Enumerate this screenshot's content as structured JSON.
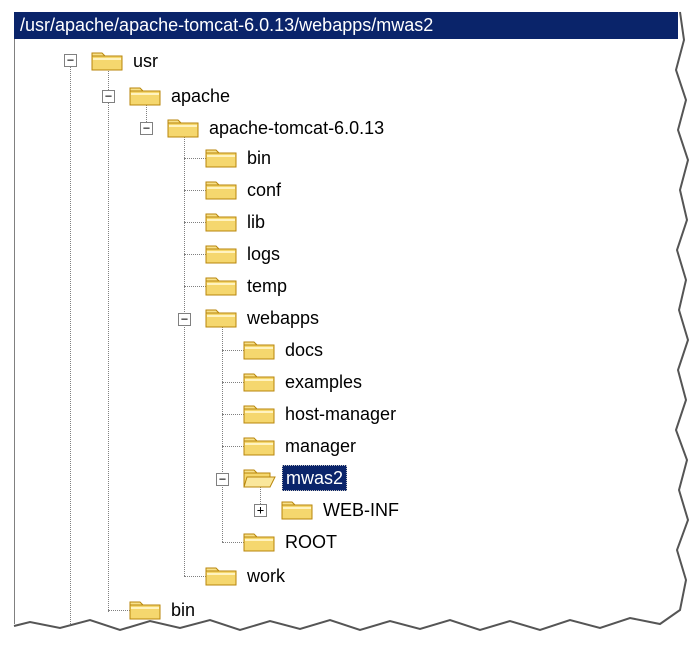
{
  "path_bar": {
    "text": "/usr/apache/apache-tomcat-6.0.13/webapps/mwas2"
  },
  "colors": {
    "selection": "#0a246a",
    "folder": "#f5d76e",
    "folder_edge": "#b8860b",
    "tree_line": "#808080"
  },
  "tree": {
    "usr": "usr",
    "apache": "apache",
    "tomcat": "apache-tomcat-6.0.13",
    "bin": "bin",
    "conf": "conf",
    "lib": "lib",
    "logs": "logs",
    "temp": "temp",
    "webapps": "webapps",
    "docs": "docs",
    "examples": "examples",
    "host_manager": "host-manager",
    "manager": "manager",
    "mwas2": "mwas2",
    "web_inf": "WEB-INF",
    "root": "ROOT",
    "work": "work",
    "bin2": "bin"
  },
  "toggles": {
    "expanded": "−",
    "collapsed": "+"
  }
}
